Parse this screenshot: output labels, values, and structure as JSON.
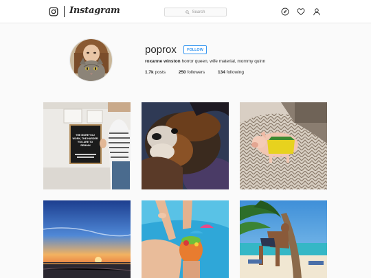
{
  "header": {
    "brand": "Instagram",
    "search_placeholder": "Search",
    "icons": [
      "instagram-camera-icon",
      "compass-icon",
      "heart-icon",
      "person-icon"
    ]
  },
  "profile": {
    "username": "poprox",
    "follow_label": "FOLLOW",
    "full_name": "roxanne winston",
    "bio": "horror queen, wife material, mommy quinn",
    "posts_count": "1.7k",
    "posts_label": "posts",
    "followers_count": "250",
    "followers_label": "followers",
    "following_count": "134",
    "following_label": "following"
  },
  "posts": [
    {
      "name": "letterboard-photo",
      "sign_text": "THE MORE YOU WORK, THE HARDER YOU ARE TO REMAIN"
    },
    {
      "name": "dog-photo"
    },
    {
      "name": "pig-photo"
    },
    {
      "name": "sunset-photo"
    },
    {
      "name": "poolside-drink-photo"
    },
    {
      "name": "beach-palm-photo"
    }
  ],
  "colors": {
    "link_blue": "#3897f0",
    "text": "#262626",
    "background": "#fafafa"
  }
}
